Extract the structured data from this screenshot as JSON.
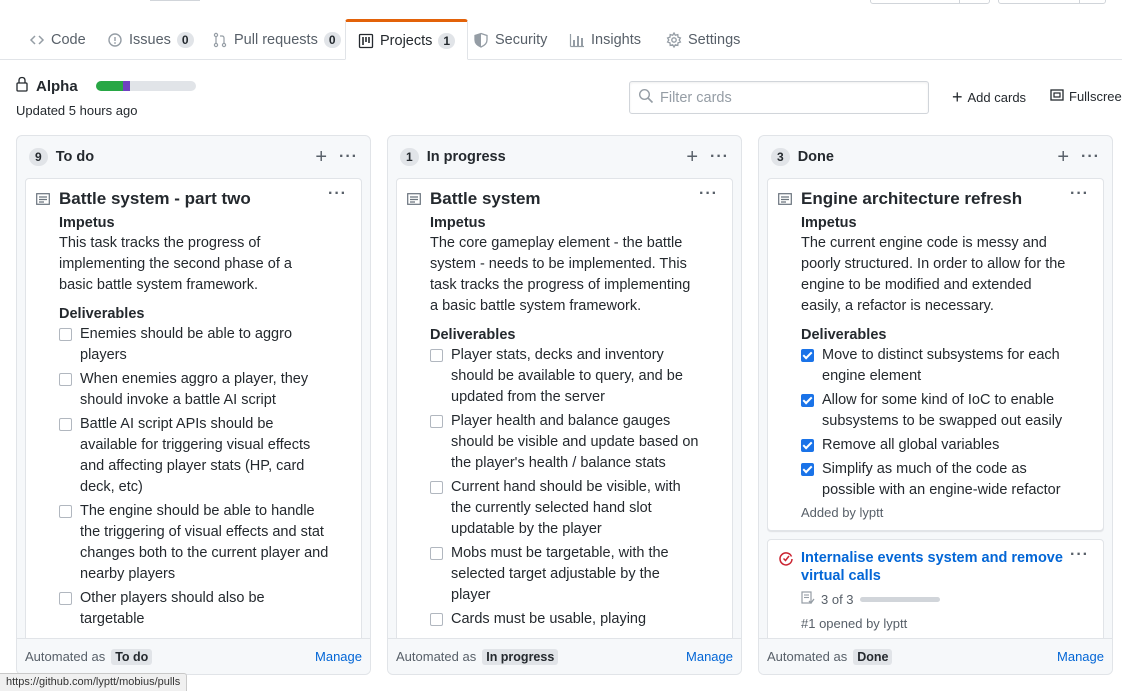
{
  "tabs": [
    {
      "label": "Code",
      "icon": "code-icon"
    },
    {
      "label": "Issues",
      "count": "0",
      "icon": "issue-opened-icon"
    },
    {
      "label": "Pull requests",
      "count": "0",
      "icon": "git-pull-request-icon"
    },
    {
      "label": "Projects",
      "count": "1",
      "icon": "project-icon",
      "selected": true
    },
    {
      "label": "Security",
      "icon": "shield-icon"
    },
    {
      "label": "Insights",
      "icon": "graph-icon"
    },
    {
      "label": "Settings",
      "icon": "gear-icon"
    }
  ],
  "project": {
    "name": "Alpha",
    "updated": "Updated 5 hours ago",
    "progress": {
      "done_pct": 27,
      "in_progress_pct": 7
    }
  },
  "toolbar": {
    "filter_placeholder": "Filter cards",
    "add_cards": "Add cards",
    "fullscreen": "Fullscreen"
  },
  "columns": [
    {
      "name": "To do",
      "count": "9",
      "automated_label": "Automated as",
      "automated_value": "To do",
      "manage": "Manage",
      "cards": [
        {
          "title": "Battle system - part two",
          "impetus_heading": "Impetus",
          "impetus": "This task tracks the progress of implementing the second phase of a basic battle system framework.",
          "deliverables_heading": "Deliverables",
          "items": [
            "Enemies should be able to aggro players",
            "When enemies aggro a player, they should invoke a battle AI script",
            "Battle AI script APIs should be available for triggering visual effects and affecting player stats (HP, card deck, etc)",
            "The engine should be able to handle the triggering of visual effects and stat changes both to the current player and nearby players",
            "Other players should also be targetable"
          ]
        }
      ]
    },
    {
      "name": "In progress",
      "count": "1",
      "automated_label": "Automated as",
      "automated_value": "In progress",
      "manage": "Manage",
      "cards": [
        {
          "title": "Battle system",
          "impetus_heading": "Impetus",
          "impetus": "The core gameplay element - the battle system - needs to be implemented. This task tracks the progress of implementing a basic battle system framework.",
          "deliverables_heading": "Deliverables",
          "items": [
            "Player stats, decks and inventory should be available to query, and be updated from the server",
            "Player health and balance gauges should be visible and update based on the player's health / balance stats",
            "Current hand should be visible, with the currently selected hand slot updatable by the player",
            "Mobs must be targetable, with the selected target adjustable by the player",
            "Cards must be usable, playing"
          ]
        }
      ]
    },
    {
      "name": "Done",
      "count": "3",
      "automated_label": "Automated as",
      "automated_value": "Done",
      "manage": "Manage",
      "cards": [
        {
          "title": "Engine architecture refresh",
          "impetus_heading": "Impetus",
          "impetus": "The current engine code is messy and poorly structured. In order to allow for the engine to be modified and extended easily, a refactor is necessary.",
          "deliverables_heading": "Deliverables",
          "items": [
            "Move to distinct subsystems for each engine element",
            "Allow for some kind of IoC to enable subsystems to be swapped out easily",
            "Remove all global variables",
            "Simplify as much of the code as possible with an engine-wide refactor"
          ],
          "added_by": "Added by lyptt"
        }
      ],
      "issue": {
        "title": "Internalise events system and remove virtual calls",
        "tasks": "3 of 3",
        "opened": "#1 opened by lyptt"
      }
    }
  ],
  "statusbar": "https://github.com/lyptt/mobius/pulls"
}
